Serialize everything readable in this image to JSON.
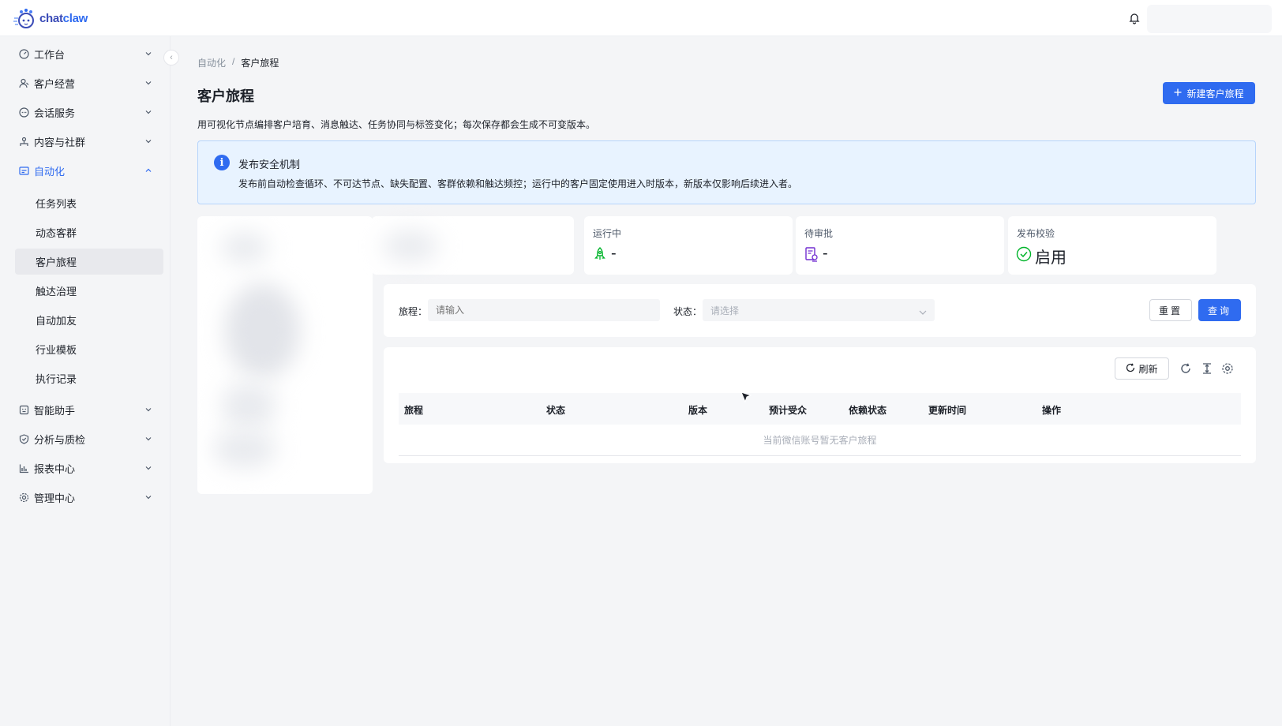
{
  "app": {
    "logo_text_a": "chat",
    "logo_text_b": "claw"
  },
  "sidebar": {
    "items": [
      {
        "label": "工作台",
        "icon": "dashboard-icon"
      },
      {
        "label": "客户经营",
        "icon": "customer-icon"
      },
      {
        "label": "会话服务",
        "icon": "chat-icon"
      },
      {
        "label": "内容与社群",
        "icon": "community-icon"
      },
      {
        "label": "自动化",
        "icon": "automation-icon",
        "active": true
      },
      {
        "label": "智能助手",
        "icon": "assistant-icon"
      },
      {
        "label": "分析与质检",
        "icon": "shield-check-icon"
      },
      {
        "label": "报表中心",
        "icon": "bar-chart-icon"
      },
      {
        "label": "管理中心",
        "icon": "gear-icon"
      }
    ],
    "automation_sub": [
      {
        "label": "任务列表"
      },
      {
        "label": "动态客群"
      },
      {
        "label": "客户旅程",
        "selected": true
      },
      {
        "label": "触达治理"
      },
      {
        "label": "自动加友"
      },
      {
        "label": "行业模板"
      },
      {
        "label": "执行记录"
      }
    ]
  },
  "breadcrumb": {
    "parent": "自动化",
    "separator": "/",
    "current": "客户旅程"
  },
  "page": {
    "title": "客户旅程",
    "new_button": "新建客户旅程",
    "description": "用可视化节点编排客户培育、消息触达、任务协同与标签变化；每次保存都会生成不可变版本。"
  },
  "alert": {
    "title": "发布安全机制",
    "text": "发布前自动检查循环、不可达节点、缺失配置、客群依赖和触达频控；运行中的客户固定使用进入时版本，新版本仅影响后续进入者。"
  },
  "stats": [
    {
      "title": "运行中",
      "value": "-",
      "icon": "rocket-icon"
    },
    {
      "title": "待审批",
      "value": "-",
      "icon": "approval-doc-icon"
    },
    {
      "title": "发布校验",
      "value": "启用",
      "icon": "check-circle-icon"
    }
  ],
  "filter": {
    "journey_label": "旅程：",
    "journey_placeholder": "请输入",
    "status_label": "状态：",
    "status_placeholder": "请选择",
    "reset": "重置",
    "query": "查询"
  },
  "table": {
    "refresh": "刷新",
    "columns": [
      "旅程",
      "状态",
      "版本",
      "预计受众",
      "依赖状态",
      "更新时间",
      "操作"
    ],
    "empty_text": "当前微信账号暂无客户旅程"
  },
  "colors": {
    "primary": "#2f6bf0",
    "alert_bg": "#e8f3ff",
    "success": "#00b42a",
    "purple": "#722ed1"
  }
}
